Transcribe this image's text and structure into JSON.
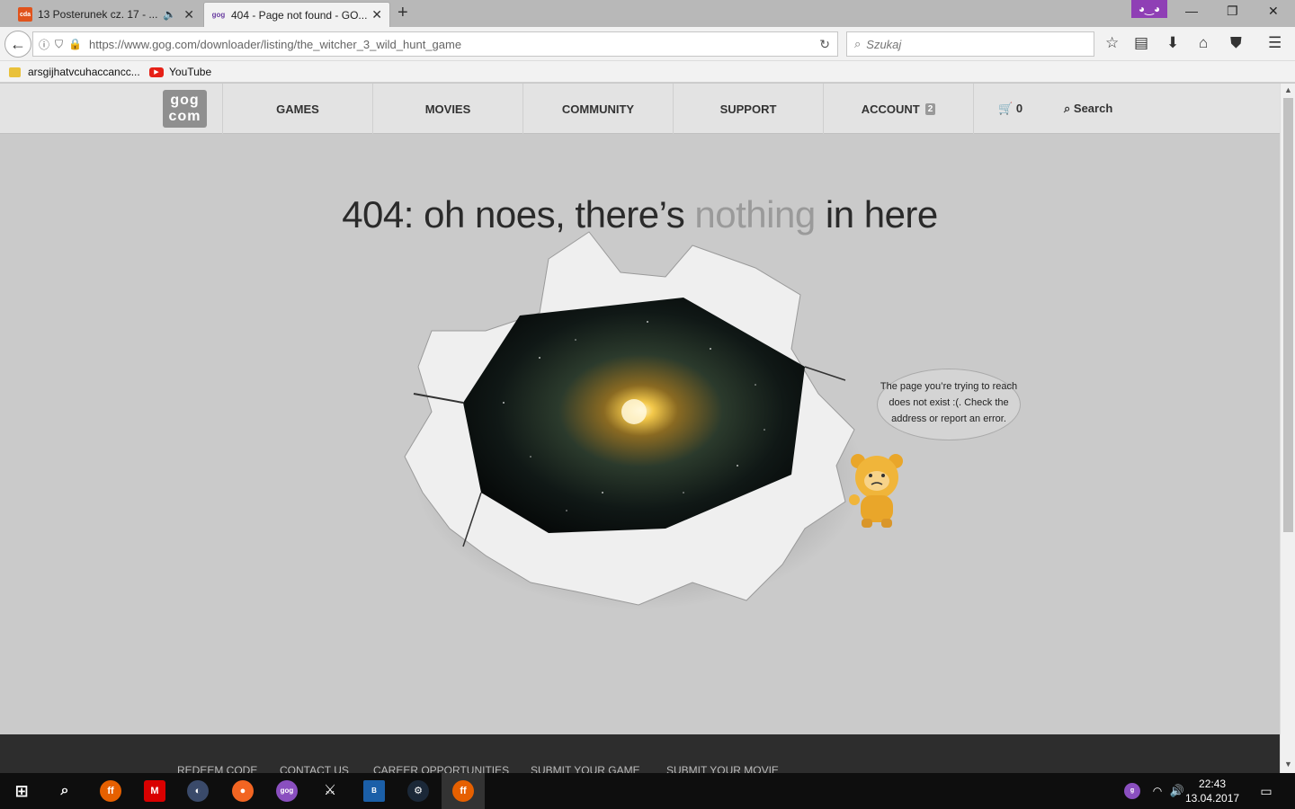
{
  "browser": {
    "tabs": [
      {
        "title": "13 Posterunek cz. 17 - ...",
        "favicon": "cda"
      },
      {
        "title": "404 - Page not found - GO...",
        "favicon": "gog"
      }
    ],
    "url": "https://www.gog.com/downloader/listing/the_witcher_3_wild_hunt_game",
    "search_placeholder": "Szukaj",
    "bookmarks": [
      {
        "label": "arsgijhatvcuhaccancc...",
        "icon": "folder-icon"
      },
      {
        "label": "YouTube",
        "icon": "youtube-icon"
      }
    ]
  },
  "gog": {
    "logo": {
      "line1": "gog",
      "line2": "com"
    },
    "nav": [
      "GAMES",
      "MOVIES",
      "COMMUNITY",
      "SUPPORT",
      "ACCOUNT"
    ],
    "account_badge": "2",
    "cart_count": "0",
    "search_label": "Search",
    "headline_pre": "404: oh noes, there’s ",
    "headline_dim": "nothing",
    "headline_post": " in here",
    "bubble_text": "The page you’re trying to reach does not exist :(. Check the address or report an error.",
    "footer_links": [
      "REDEEM CODE",
      "CONTACT US",
      "CAREER OPPORTUNITIES",
      "SUBMIT YOUR GAME",
      "SUBMIT YOUR MOVIE"
    ]
  },
  "taskbar": {
    "time": "22:43",
    "date": "13.04.2017"
  }
}
